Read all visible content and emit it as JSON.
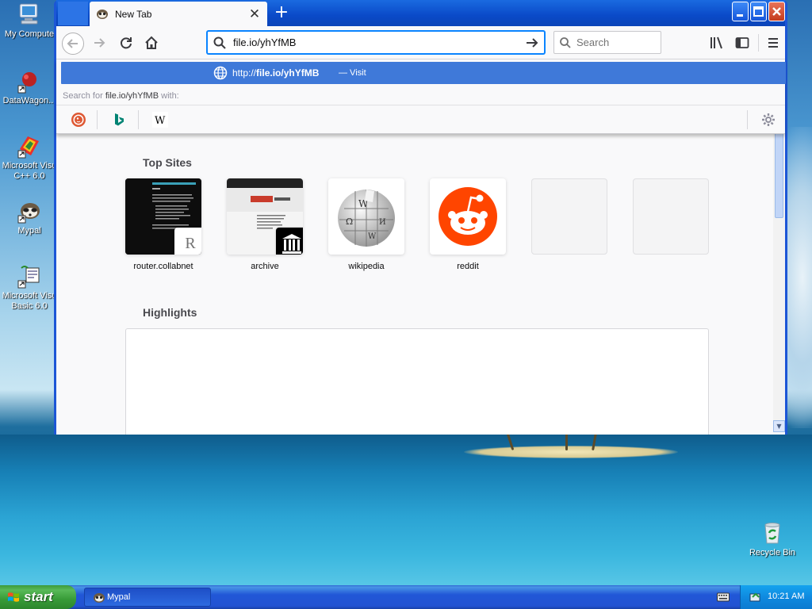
{
  "desktop": {
    "icons": [
      {
        "label": "My Compute"
      },
      {
        "label": "DataWagon..."
      },
      {
        "label": "Microsoft Visu C++ 6.0"
      },
      {
        "label": "Mypal"
      },
      {
        "label": "Microsoft Visu Basic 6.0"
      },
      {
        "label": "Recycle Bin"
      }
    ]
  },
  "browser": {
    "tab": {
      "title": "New Tab"
    },
    "urlbar": {
      "value": "file.io/yhYfMB"
    },
    "search": {
      "placeholder": "Search"
    },
    "suggestion": {
      "prefix": "http://",
      "host": "file.io/yhYfMB",
      "action": "— Visit"
    },
    "search_with": {
      "prefix": "Search for",
      "query": "file.io/yhYfMB",
      "suffix": "with:"
    },
    "engines": [
      "DuckDuckGo",
      "Bing",
      "Wikipedia"
    ],
    "newtab": {
      "top_sites_title": "Top Sites",
      "top_sites": [
        {
          "label": "router.collabnet",
          "badge": "R"
        },
        {
          "label": "archive"
        },
        {
          "label": "wikipedia"
        },
        {
          "label": "reddit"
        },
        {
          "label": ""
        },
        {
          "label": ""
        }
      ],
      "highlights_title": "Highlights"
    }
  },
  "taskbar": {
    "start_label": "start",
    "task_label": "Mypal",
    "clock": "10:21 AM"
  },
  "colors": {
    "accent": "#3f79d9",
    "reddit": "#ff4500",
    "xp_blue": "#2157d7",
    "xp_green": "#379b37"
  }
}
